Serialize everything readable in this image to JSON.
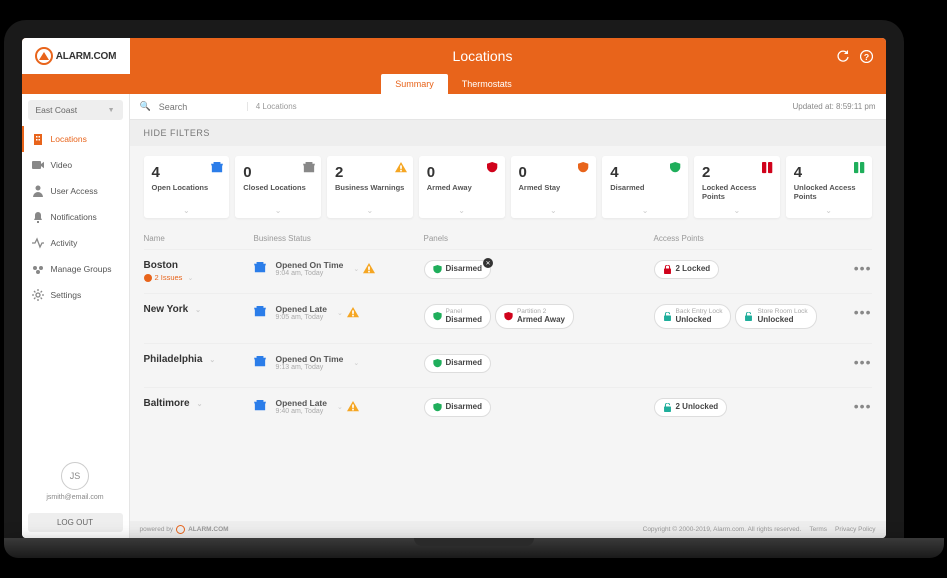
{
  "brand": "ALARM.COM",
  "header": {
    "title": "Locations",
    "tabs": [
      {
        "label": "Summary",
        "active": true
      },
      {
        "label": "Thermostats",
        "active": false
      }
    ]
  },
  "sidebar": {
    "region": "East Coast",
    "items": [
      {
        "label": "Locations",
        "icon": "building-icon",
        "active": true
      },
      {
        "label": "Video",
        "icon": "video-icon"
      },
      {
        "label": "User Access",
        "icon": "user-access-icon"
      },
      {
        "label": "Notifications",
        "icon": "bell-icon"
      },
      {
        "label": "Activity",
        "icon": "activity-icon"
      },
      {
        "label": "Manage Groups",
        "icon": "groups-icon"
      },
      {
        "label": "Settings",
        "icon": "gear-icon"
      }
    ],
    "user": {
      "initials": "JS",
      "email": "jsmith@email.com"
    },
    "logout": "LOG OUT"
  },
  "search": {
    "placeholder": "Search",
    "count_label": "4 Locations",
    "updated_label": "Updated at: 8:59:11 pm"
  },
  "filters_label": "HIDE FILTERS",
  "stats": [
    {
      "value": "4",
      "label": "Open Locations",
      "icon": "store-blue-icon"
    },
    {
      "value": "0",
      "label": "Closed Locations",
      "icon": "store-gray-icon"
    },
    {
      "value": "2",
      "label": "Business Warnings",
      "icon": "warning-icon"
    },
    {
      "value": "0",
      "label": "Armed Away",
      "icon": "shield-red-icon"
    },
    {
      "value": "0",
      "label": "Armed Stay",
      "icon": "shield-orange-icon"
    },
    {
      "value": "4",
      "label": "Disarmed",
      "icon": "shield-green-icon"
    },
    {
      "value": "2",
      "label": "Locked Access Points",
      "icon": "lock-red-icon"
    },
    {
      "value": "4",
      "label": "Unlocked Access Points",
      "icon": "lock-green-icon"
    }
  ],
  "columns": {
    "name": "Name",
    "business": "Business Status",
    "panels": "Panels",
    "access": "Access Points"
  },
  "rows": [
    {
      "name": "Boston",
      "issues": "2 Issues",
      "biz": {
        "status": "Opened On Time",
        "time": "9:04 am, Today",
        "warning": true
      },
      "panels": [
        {
          "icon": "shield-green-icon",
          "value": "Disarmed",
          "close": true
        }
      ],
      "access": [
        {
          "icon": "lock-red-icon",
          "value": "2 Locked"
        }
      ]
    },
    {
      "name": "New York",
      "biz": {
        "status": "Opened Late",
        "time": "9:05 am, Today",
        "warning": true
      },
      "panels": [
        {
          "icon": "shield-green-icon",
          "label": "Panel",
          "value": "Disarmed"
        },
        {
          "icon": "shield-red-icon",
          "label": "Partition 2",
          "value": "Armed Away"
        }
      ],
      "access": [
        {
          "icon": "unlock-green-icon",
          "label": "Back Entry Lock",
          "value": "Unlocked"
        },
        {
          "icon": "unlock-green-icon",
          "label": "Store Room Lock",
          "value": "Unlocked"
        }
      ]
    },
    {
      "name": "Philadelphia",
      "biz": {
        "status": "Opened On Time",
        "time": "9:13 am, Today"
      },
      "panels": [
        {
          "icon": "shield-green-icon",
          "value": "Disarmed"
        }
      ],
      "access": []
    },
    {
      "name": "Baltimore",
      "biz": {
        "status": "Opened Late",
        "time": "9:40 am, Today",
        "warning": true
      },
      "panels": [
        {
          "icon": "shield-green-icon",
          "value": "Disarmed"
        }
      ],
      "access": [
        {
          "icon": "unlock-green-icon",
          "value": "2 Unlocked"
        }
      ]
    }
  ],
  "footer": {
    "powered": "powered by",
    "brand": "ALARM.COM",
    "copyright": "Copyright © 2000-2019, Alarm.com. All rights reserved.",
    "links": [
      "Terms",
      "Privacy Policy"
    ]
  }
}
